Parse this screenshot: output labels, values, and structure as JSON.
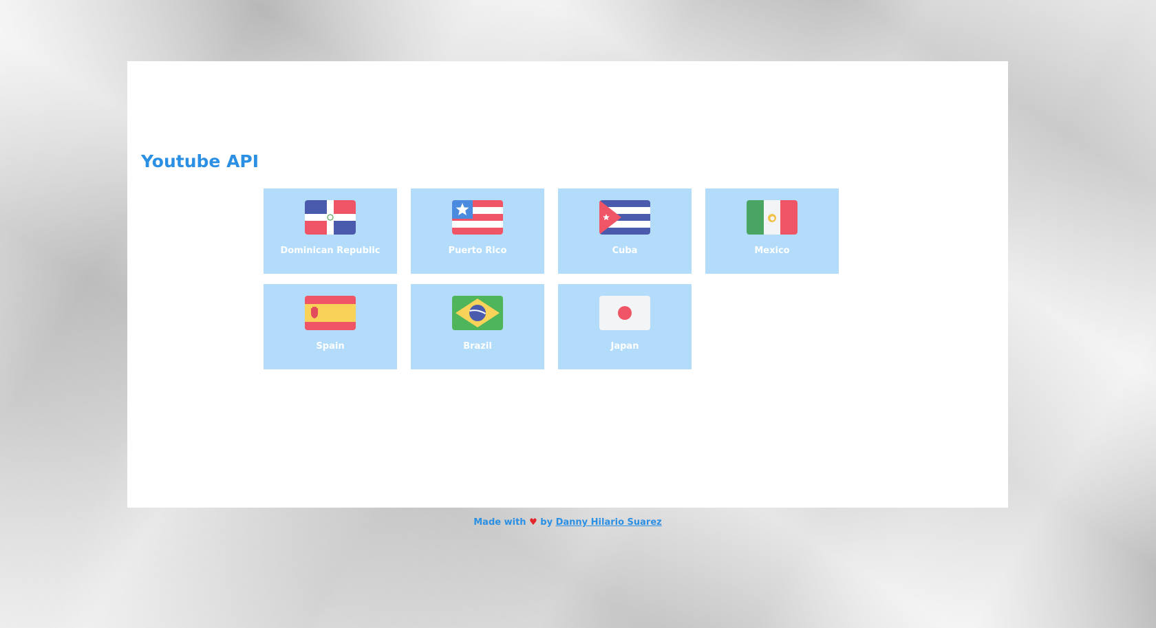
{
  "header": {
    "title": "Youtube API"
  },
  "countries": [
    {
      "name": "Dominican Republic",
      "icon": "dominican-republic-flag-icon"
    },
    {
      "name": "Puerto Rico",
      "icon": "puerto-rico-flag-icon"
    },
    {
      "name": "Cuba",
      "icon": "cuba-flag-icon"
    },
    {
      "name": "Mexico",
      "icon": "mexico-flag-icon"
    },
    {
      "name": "Spain",
      "icon": "spain-flag-icon"
    },
    {
      "name": "Brazil",
      "icon": "brazil-flag-icon"
    },
    {
      "name": "Japan",
      "icon": "japan-flag-icon"
    }
  ],
  "footer": {
    "prefix": "Made with",
    "heart": "♥",
    "by": "by",
    "author": "Danny Hilario Suarez"
  },
  "colors": {
    "accent": "#2b8fe3",
    "card": "#b3dcfb",
    "heart": "#e3242b"
  }
}
